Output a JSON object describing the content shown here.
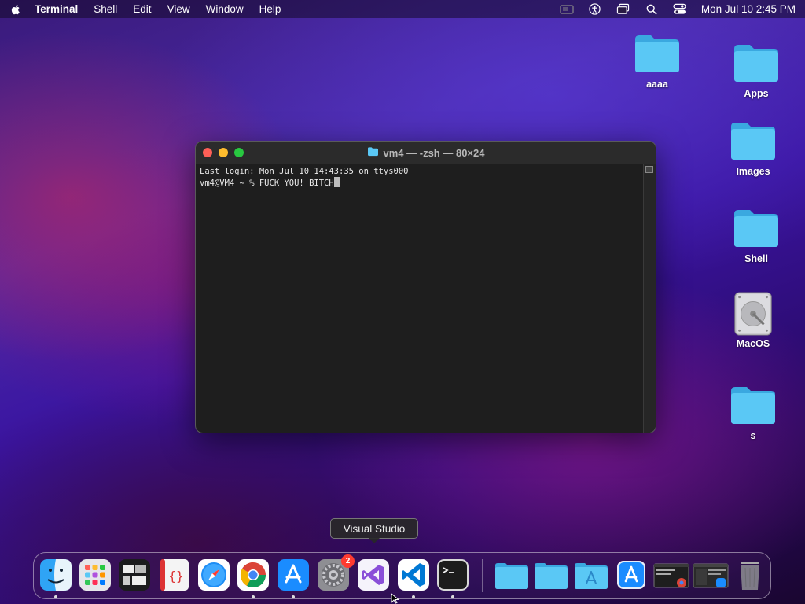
{
  "menubar": {
    "app_name": "Terminal",
    "menus": [
      "Shell",
      "Edit",
      "View",
      "Window",
      "Help"
    ],
    "clock": "Mon Jul 10  2:45 PM"
  },
  "desktop": {
    "icons": [
      {
        "label": "aaaa",
        "icon": "folder-icon"
      },
      {
        "label": "Apps",
        "icon": "folder-icon"
      },
      {
        "label": "Images",
        "icon": "folder-icon"
      },
      {
        "label": "Shell",
        "icon": "folder-icon"
      },
      {
        "label": "MacOS",
        "icon": "hard-drive-icon"
      },
      {
        "label": "s",
        "icon": "folder-icon"
      }
    ]
  },
  "terminal": {
    "title": "vm4 — -zsh — 80×24",
    "lines": [
      "Last login: Mon Jul 10 14:43:35 on ttys000",
      "vm4@VM4 ~ % FUCK YOU! BITCH"
    ]
  },
  "tooltip": {
    "text": "Visual Studio"
  },
  "dock": {
    "apps": [
      {
        "name": "Finder",
        "icon": "finder-icon"
      },
      {
        "name": "Launchpad",
        "icon": "launchpad-icon"
      },
      {
        "name": "Mission Control",
        "icon": "mission-control-icon"
      },
      {
        "name": "Script Editor",
        "icon": "script-editor-icon"
      },
      {
        "name": "Safari",
        "icon": "safari-icon"
      },
      {
        "name": "Google Chrome",
        "icon": "chrome-icon"
      },
      {
        "name": "App Store",
        "icon": "app-store-icon"
      },
      {
        "name": "System Preferences",
        "icon": "system-preferences-icon",
        "badge": "2"
      },
      {
        "name": "Visual Studio",
        "icon": "visual-studio-icon"
      },
      {
        "name": "Visual Studio Code",
        "icon": "vscode-icon"
      },
      {
        "name": "Terminal",
        "icon": "terminal-icon"
      }
    ],
    "colors": {
      "folder": "#5ac8f5",
      "folder_dark": "#3aa8e0",
      "badge": "#ff3b30"
    }
  }
}
